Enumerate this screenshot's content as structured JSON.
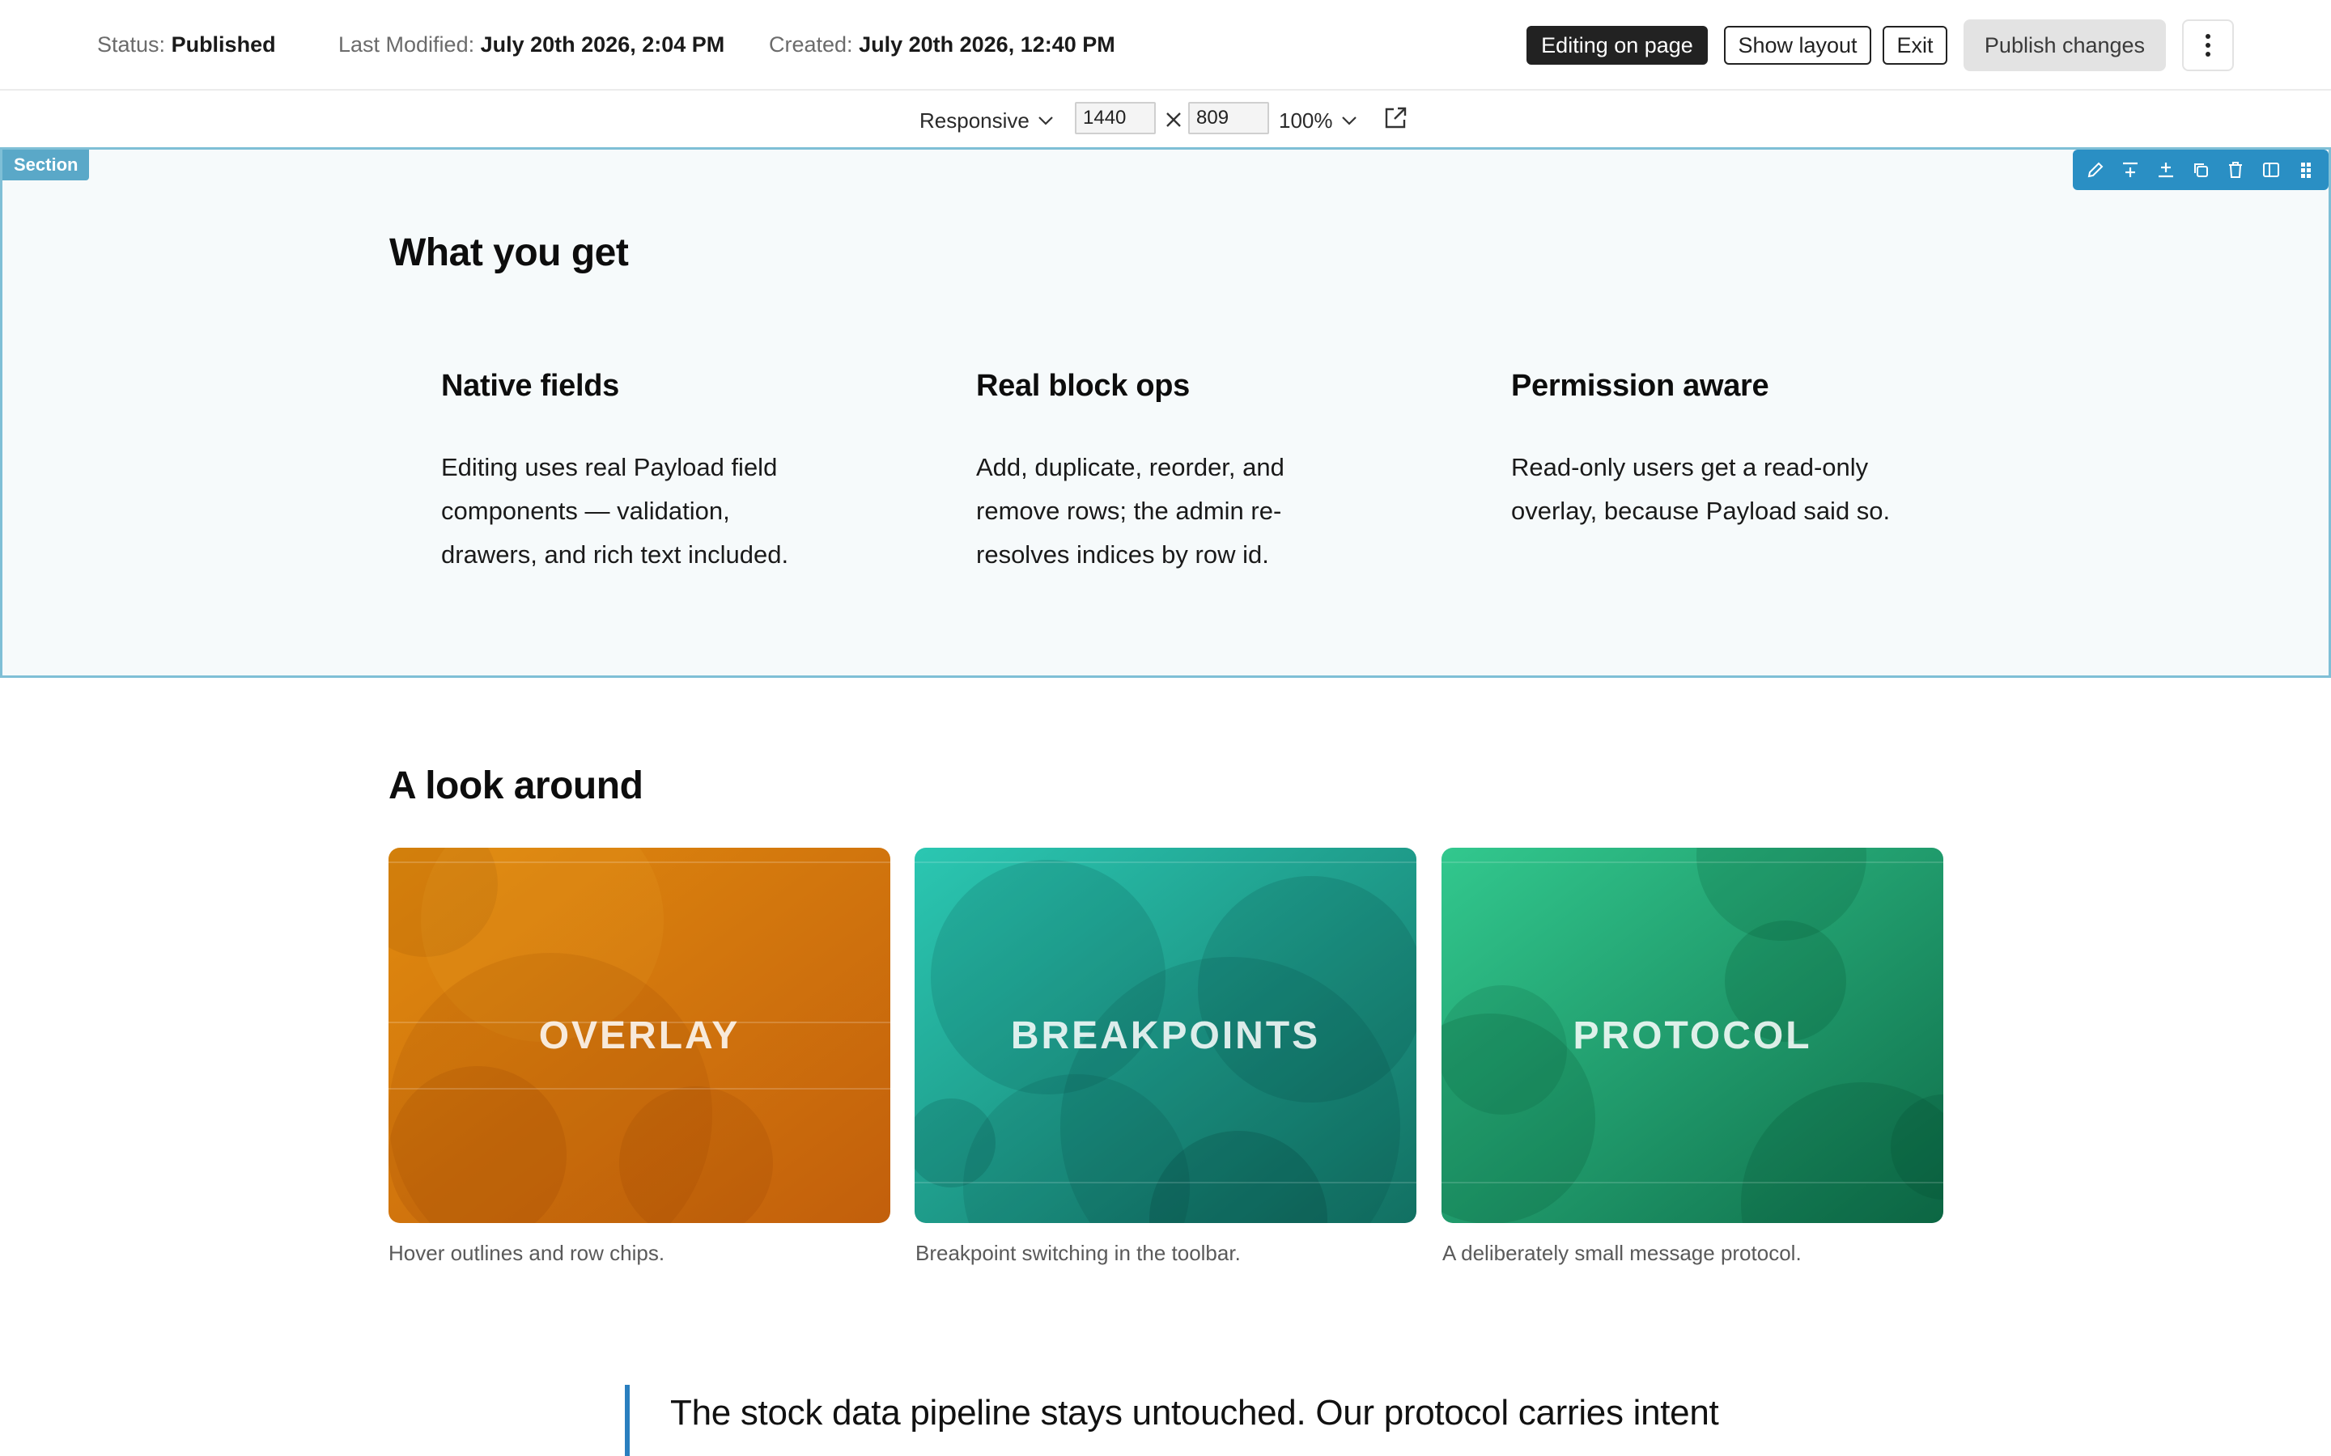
{
  "header": {
    "status_label": "Status:",
    "status_value": "Published",
    "modified_label": "Last Modified:",
    "modified_value": "July 20th 2026, 2:04 PM",
    "created_label": "Created:",
    "created_value": "July 20th 2026, 12:40 PM",
    "buttons": {
      "editing": "Editing on page",
      "layout": "Show layout",
      "exit": "Exit",
      "publish": "Publish changes"
    }
  },
  "viewport": {
    "mode": "Responsive",
    "width": "1440",
    "height": "809",
    "zoom": "100%"
  },
  "section": {
    "tag": "Section",
    "heading": "What you get",
    "features": [
      {
        "title": "Native fields",
        "body": "Editing uses real Payload field components — validation, drawers, and rich text included."
      },
      {
        "title": "Real block ops",
        "body": "Add, duplicate, reorder, and remove rows; the admin re-resolves indices by row id."
      },
      {
        "title": "Permission aware",
        "body": "Read-only users get a read-only overlay, because Payload said so."
      }
    ]
  },
  "gallery": {
    "heading": "A look around",
    "cards": [
      {
        "label": "OVERLAY",
        "caption": "Hover outlines and row chips.",
        "color_from": "#e08a0e",
        "color_to": "#c25f0c"
      },
      {
        "label": "BREAKPOINTS",
        "caption": "Breakpoint switching in the toolbar.",
        "color_from": "#2bc7b2",
        "color_to": "#127062"
      },
      {
        "label": "PROTOCOL",
        "caption": "A deliberately small message protocol.",
        "color_from": "#32c88e",
        "color_to": "#0f6e4a"
      }
    ]
  },
  "quote": {
    "text": "The stock data pipeline stays untouched. Our protocol carries intent"
  },
  "colors": {
    "accent": "#2a8fc4",
    "section_outline": "#7fbfd6",
    "section_tag": "#5aa8c8"
  }
}
